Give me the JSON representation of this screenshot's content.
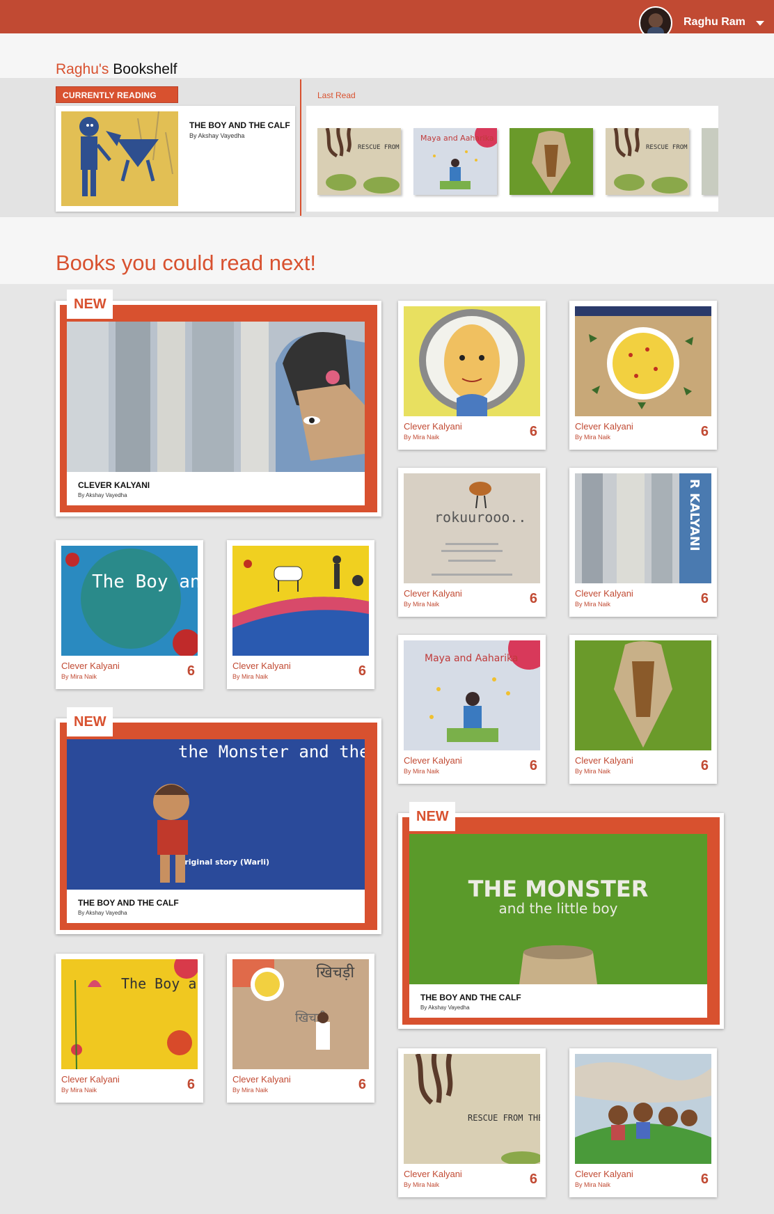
{
  "topbar": {
    "username": "Raghu Ram"
  },
  "shelf": {
    "owner": "Raghu's",
    "title": "Bookshelf"
  },
  "currently_reading": {
    "tag": "CURRENTLY READING",
    "book_title": "THE BOY AND THE CALF",
    "book_author": "By Akshay Vayedha"
  },
  "last_read": {
    "label": "Last Read",
    "covers": [
      "RESCUE FROM THE CLAW",
      "Maya and Aaharika",
      "",
      "RESCUE FROM THE CLAW"
    ]
  },
  "next": {
    "title": "Books you could read next!"
  },
  "featured": [
    {
      "badge": "NEW",
      "title": "CLEVER KALYANI",
      "author": "By Akshay Vayedha",
      "cover_text": ""
    },
    {
      "badge": "NEW",
      "title": "THE BOY AND THE CALF",
      "author": "By Akshay Vayedha",
      "cover_text": "the Monster and the little boy",
      "cover_sub": "Original story (Warli)"
    },
    {
      "badge": "NEW",
      "title": "THE BOY AND THE CALF",
      "author": "By Akshay Vayedha",
      "cover_text": "THE MONSTER",
      "cover_sub": "and the little boy"
    }
  ],
  "cards": [
    {
      "title": "Clever Kalyani",
      "author": "By Mira Naik",
      "level": "6",
      "cover_text": ""
    },
    {
      "title": "Clever Kalyani",
      "author": "By Mira Naik",
      "level": "6",
      "cover_text": ""
    },
    {
      "title": "Clever Kalyani",
      "author": "By Mira Naik",
      "level": "6",
      "cover_text": "rokuurooo.."
    },
    {
      "title": "Clever Kalyani",
      "author": "By Mira Naik",
      "level": "6",
      "cover_text": "R KALYANI"
    },
    {
      "title": "Clever Kalyani",
      "author": "By Mira Naik",
      "level": "6",
      "cover_text": "The Boy and the calf"
    },
    {
      "title": "Clever Kalyani",
      "author": "By Mira Naik",
      "level": "6",
      "cover_text": ""
    },
    {
      "title": "Clever Kalyani",
      "author": "By Mira Naik",
      "level": "6",
      "cover_text": "Maya and Aaharika"
    },
    {
      "title": "Clever Kalyani",
      "author": "By Mira Naik",
      "level": "6",
      "cover_text": ""
    },
    {
      "title": "Clever Kalyani",
      "author": "By Mira Naik",
      "level": "6",
      "cover_text": "The Boy and the Calf"
    },
    {
      "title": "Clever Kalyani",
      "author": "By Mira Naik",
      "level": "6",
      "cover_text": "खिचड़ी"
    },
    {
      "title": "Clever Kalyani",
      "author": "By Mira Naik",
      "level": "6",
      "cover_text": "RESCUE FROM THE CLAW"
    },
    {
      "title": "Clever Kalyani",
      "author": "By Mira Naik",
      "level": "6",
      "cover_text": ""
    }
  ]
}
